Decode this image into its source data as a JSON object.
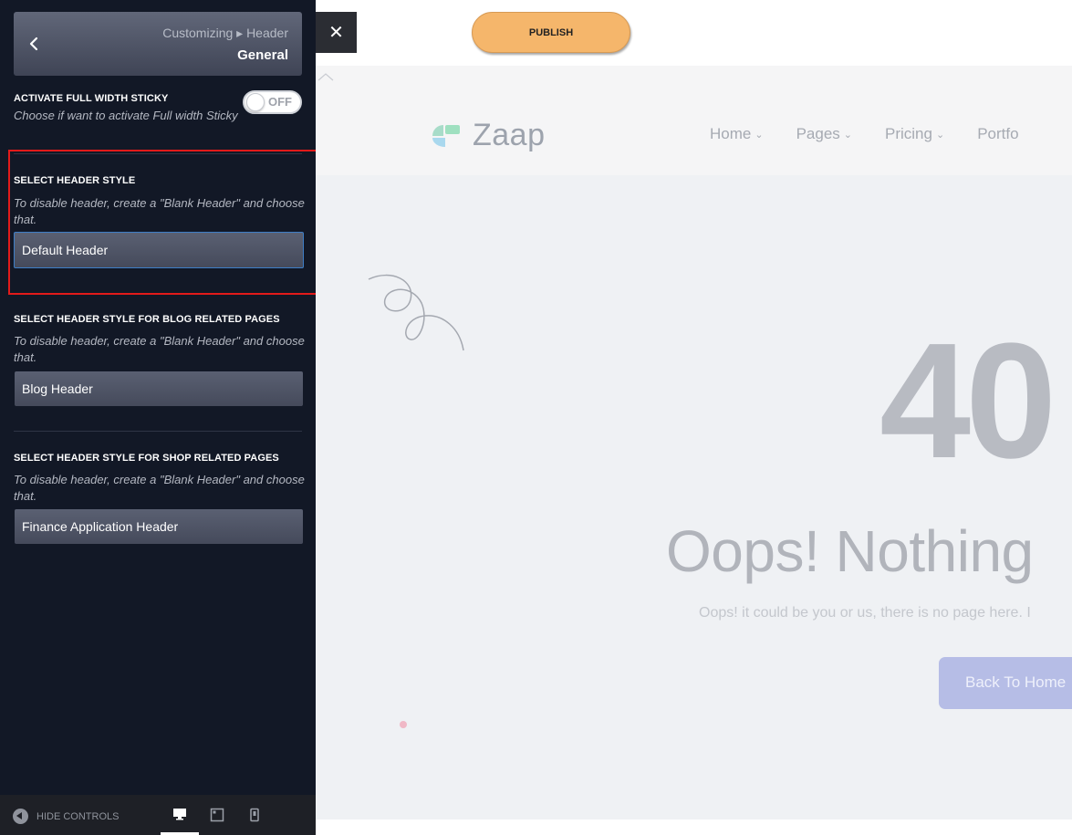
{
  "sidebar": {
    "breadcrumb": "Customizing ▸ Header",
    "section_title": "General",
    "full_width_sticky": {
      "label": "ACTIVATE FULL WIDTH STICKY",
      "description": "Choose if want to activate Full width Sticky",
      "toggle_state": "OFF"
    },
    "header_style": {
      "label": "SELECT HEADER STYLE",
      "description": "To disable header, create a \"Blank Header\" and choose that.",
      "selected": "Default Header"
    },
    "blog_header_style": {
      "label": "SELECT HEADER STYLE FOR BLOG RELATED PAGES",
      "description": "To disable header, create a \"Blank Header\" and choose that.",
      "selected": "Blog Header"
    },
    "shop_header_style": {
      "label": "SELECT HEADER STYLE FOR SHOP RELATED PAGES",
      "description": "To disable header, create a \"Blank Header\" and choose that.",
      "selected": "Finance Application Header"
    },
    "footer": {
      "hide_controls": "HIDE CONTROLS"
    }
  },
  "toolbar": {
    "close_glyph": "✕",
    "publish_label": "PUBLISH"
  },
  "preview": {
    "logo_text": "Zaap",
    "nav": [
      "Home",
      "Pages",
      "Pricing",
      "Portfo"
    ],
    "error_code": "40",
    "headline": "Oops! Nothing",
    "subtext": "Oops! it could be you or us, there is no page here. I",
    "button_label": "Back To Home"
  },
  "colors": {
    "sidebar_bg": "#121826",
    "publish_bg": "#f5b66b",
    "highlight": "#e21a1a",
    "home_button": "#b6bde6"
  }
}
